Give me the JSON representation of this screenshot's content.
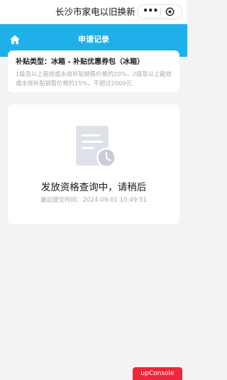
{
  "app": {
    "title": "长沙市家电以旧换新",
    "capsule": {
      "more_label": "•••",
      "close_icon": "close-circle-icon"
    }
  },
  "navbar": {
    "title": "申请记录",
    "home_icon": "home-icon",
    "background_color": "#1fb0ea"
  },
  "subsidy_card": {
    "type_line": "补贴类型：冰箱 - 补贴优惠券包（冰箱）",
    "description": "1级及以上能效或水效补贴销售价格的20%，2级及以上能效或水效补贴销售价格的15%，不超过2000元"
  },
  "status_card": {
    "illustration_icon": "document-clock-icon",
    "status_title": "发放资格查询中，请稍后",
    "submit_time": "最后提交时间：2024-09-01 10:49:51"
  },
  "debug": {
    "console_label": "upConsole",
    "console_color": "#f0263b"
  }
}
